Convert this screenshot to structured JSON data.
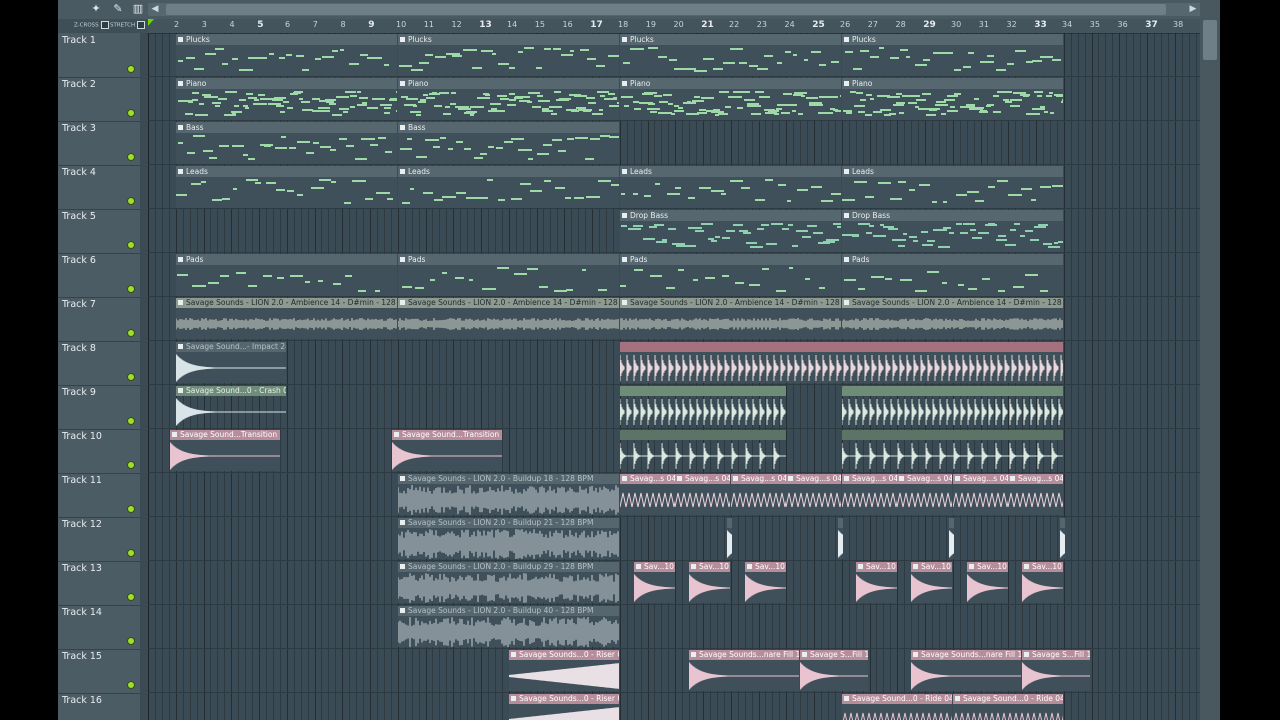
{
  "toolbar": {
    "zcross_label": "Z-CROSS",
    "stretch_label": "STRETCH"
  },
  "ruler": {
    "bars": [
      "2",
      "3",
      "4",
      "5",
      "6",
      "7",
      "8",
      "9",
      "10",
      "11",
      "12",
      "13",
      "14",
      "15",
      "16",
      "17",
      "18",
      "19",
      "20",
      "21",
      "22",
      "23",
      "24",
      "25",
      "26",
      "27",
      "28",
      "29",
      "30",
      "31",
      "32",
      "33",
      "34",
      "35",
      "36",
      "37",
      "38"
    ],
    "emphasized": [
      "5",
      "9",
      "13",
      "17",
      "21",
      "25",
      "29",
      "33",
      "37"
    ]
  },
  "tracks": [
    {
      "name": "Track 1"
    },
    {
      "name": "Track 2"
    },
    {
      "name": "Track 3"
    },
    {
      "name": "Track 4"
    },
    {
      "name": "Track 5"
    },
    {
      "name": "Track 6"
    },
    {
      "name": "Track 7"
    },
    {
      "name": "Track 8"
    },
    {
      "name": "Track 9"
    },
    {
      "name": "Track 10"
    },
    {
      "name": "Track 11"
    },
    {
      "name": "Track 12"
    },
    {
      "name": "Track 13"
    },
    {
      "name": "Track 14"
    },
    {
      "name": "Track 15"
    },
    {
      "name": "Track 16"
    }
  ],
  "clip_labels": {
    "plucks": "Plucks",
    "piano": "Piano",
    "bass": "Bass",
    "leads": "Leads",
    "drop_bass": "Drop Bass",
    "pads": "Pads",
    "ambience": "Savage Sounds - LION 2.0 - Ambience 14 - D#min - 128 BPM",
    "impact": "Savage Sound...- Impact 24",
    "crash": "Savage Sound...0 - Crash 03",
    "transition": "Savage Sound...Transition 02",
    "buildup18": "Savage Sounds - LION 2.0 - Buildup 18 - 128 BPM",
    "buildup21": "Savage Sounds - LION 2.0 - Buildup 21 - 128 BPM",
    "buildup29": "Savage Sounds - LION 2.0 - Buildup 29 - 128 BPM",
    "buildup40": "Savage Sounds - LION 2.0 - Buildup 40 - 128 BPM",
    "savag04": "Savag...s 04",
    "sav10": "Sav...10",
    "riser01": "Savage Sounds...0 - Riser 01",
    "riser02": "Savage Sounds...0 - Riser 02",
    "snarefill": "Savage Sounds...nare Fill 14",
    "fill14short": "Savage S...Fill 14",
    "ride04": "Savage Sound...0 - Ride 04"
  },
  "colors": {
    "background": "#3a4b55",
    "note": "#9ed9a8",
    "led": "#9be02a",
    "playhead": "#6dd400"
  }
}
